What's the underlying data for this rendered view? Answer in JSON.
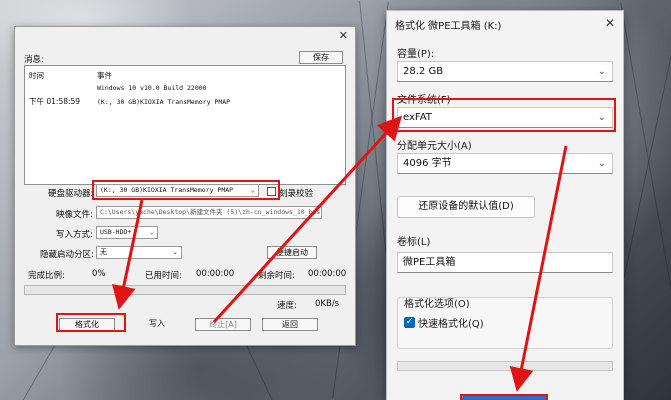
{
  "left_dialog": {
    "messages_label": "消息:",
    "save_button": "保存",
    "messages": {
      "col_time": "时间",
      "col_event": "事件",
      "rows": [
        {
          "time": "",
          "event": "Windows 10 v10.0 Build 22000"
        },
        {
          "time": "下午 01:58:59",
          "event": "(K:, 30 GB)KIOXIA  TransMemory   PMAP"
        }
      ]
    },
    "drive_label": "硬盘驱动器:",
    "drive_value": "(K:, 30 GB)KIOXIA  TransMemory   PMAP",
    "verify_label": "刻录校验",
    "image_label": "映像文件:",
    "image_value": "C:\\Users\\yache\\Desktop\\新建文件夹 (5)\\zh-cn_windows_10_bus",
    "write_mode_label": "写入方式:",
    "write_mode_value": "USB-HDD+",
    "hidden_part_label": "隐藏启动分区:",
    "hidden_part_value": "无",
    "easy_boot_button": "便捷启动",
    "completed_label": "完成比例:",
    "completed_value": "0%",
    "elapsed_label": "已用时间:",
    "elapsed_value": "00:00:00",
    "remaining_label": "剩余时间:",
    "remaining_value": "00:00:00",
    "speed_label": "速度:",
    "speed_value": "0KB/s",
    "format_button": "格式化",
    "write_button": "写入",
    "stop_button": "终止[A]",
    "back_button": "返回",
    "progress_percent": 0
  },
  "right_dialog": {
    "title": "格式化 微PE工具箱 (K:)",
    "capacity_label": "容量(P):",
    "capacity_value": "28.2 GB",
    "filesystem_label": "文件系统(F)",
    "filesystem_value": "exFAT",
    "alloc_label": "分配单元大小(A)",
    "alloc_value": "4096 字节",
    "restore_button": "还原设备的默认值(D)",
    "volume_label_label": "卷标(L)",
    "volume_label_value": "微PE工具箱",
    "format_options_label": "格式化选项(O)",
    "quick_format_label": "快速格式化(Q)",
    "quick_format_checked": true,
    "progress_percent": 0
  },
  "colors": {
    "highlight": "#e01414",
    "accent": "#0067c0"
  }
}
